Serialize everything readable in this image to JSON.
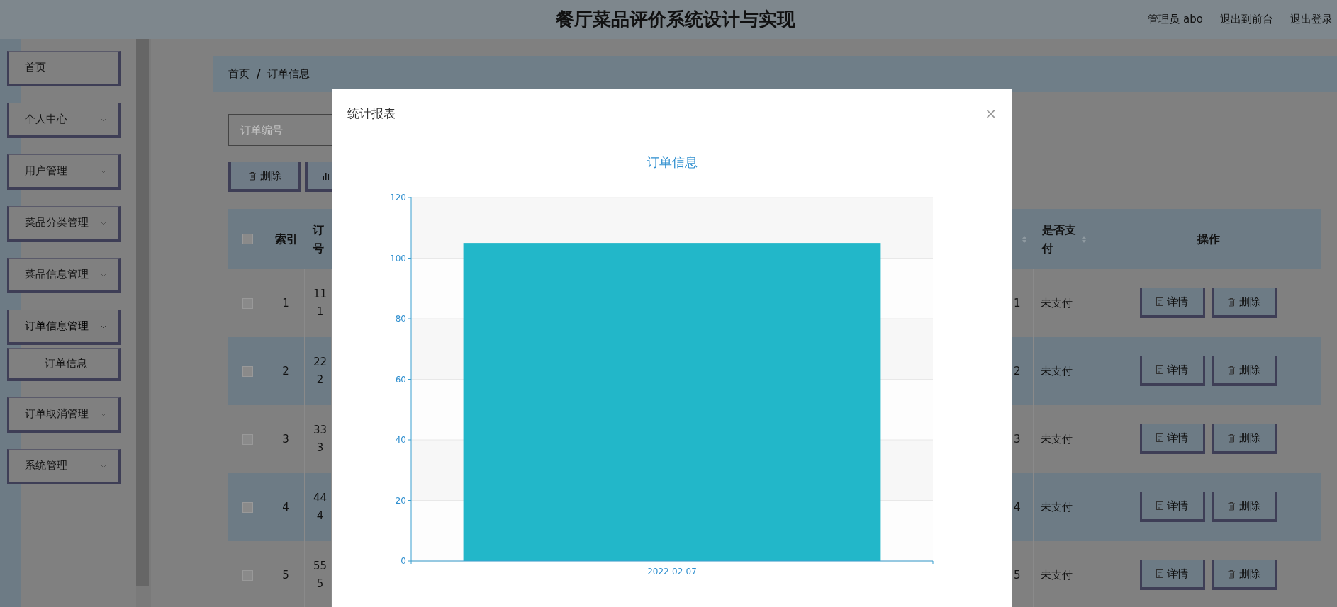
{
  "header": {
    "title": "餐厅菜品评价系统设计与实现",
    "links": [
      "管理员 abo",
      "退出到前台",
      "退出登录"
    ]
  },
  "sidebar": {
    "items": [
      {
        "label": "首页",
        "has_children": false,
        "expanded": false
      },
      {
        "label": "个人中心",
        "has_children": true,
        "expanded": false
      },
      {
        "label": "用户管理",
        "has_children": true,
        "expanded": false
      },
      {
        "label": "菜品分类管理",
        "has_children": true,
        "expanded": false
      },
      {
        "label": "菜品信息管理",
        "has_children": true,
        "expanded": false
      },
      {
        "label": "订单信息管理",
        "has_children": true,
        "expanded": true,
        "children": [
          {
            "label": "订单信息"
          }
        ]
      },
      {
        "label": "订单取消管理",
        "has_children": true,
        "expanded": false
      },
      {
        "label": "系统管理",
        "has_children": true,
        "expanded": false
      }
    ]
  },
  "breadcrumb": {
    "items": [
      "首页",
      "订单信息"
    ],
    "separator": "/"
  },
  "search": {
    "placeholder": "订单编号"
  },
  "toolbar": [
    {
      "kind": "delete",
      "label": "删除"
    },
    {
      "kind": "chart"
    }
  ],
  "table": {
    "header_checked": false,
    "columns": [
      {
        "label": "索引",
        "sortable": false
      },
      {
        "label": "订号",
        "sortable": false
      },
      {
        "sortable": true
      },
      {
        "label": "是否支付",
        "sortable": true
      },
      {
        "label": "操作",
        "sortable": false
      }
    ],
    "rows": [
      {
        "checked": false,
        "index": "1",
        "column_3": [
          "11",
          "1"
        ],
        "column_4": "1",
        "paid": "未支付",
        "actions": [
          "详情",
          "删除"
        ]
      },
      {
        "checked": false,
        "index": "2",
        "column_3": [
          "22",
          "2"
        ],
        "column_4": "2",
        "paid": "未支付",
        "actions": [
          "详情",
          "删除"
        ]
      },
      {
        "checked": false,
        "index": "3",
        "column_3": [
          "33",
          "3"
        ],
        "column_4": "3",
        "paid": "未支付",
        "actions": [
          "详情",
          "删除"
        ]
      },
      {
        "checked": false,
        "index": "4",
        "column_3": [
          "44",
          "4"
        ],
        "column_4": "4",
        "paid": "未支付",
        "actions": [
          "详情",
          "删除"
        ]
      },
      {
        "checked": false,
        "index": "5",
        "column_3": [
          "55",
          "5"
        ],
        "column_4": "5",
        "paid": "未支付",
        "actions": [
          "详情",
          "删除"
        ]
      }
    ]
  },
  "modal": {
    "title": "统计报表",
    "close": "×",
    "chart_data": {
      "type": "bar",
      "title": "订单信息",
      "categories": [
        "2022-02-07"
      ],
      "values": [
        105
      ],
      "ylim": [
        0,
        120
      ],
      "grid": true,
      "yticks": [
        0,
        20,
        40,
        60,
        80,
        100,
        120
      ]
    }
  }
}
